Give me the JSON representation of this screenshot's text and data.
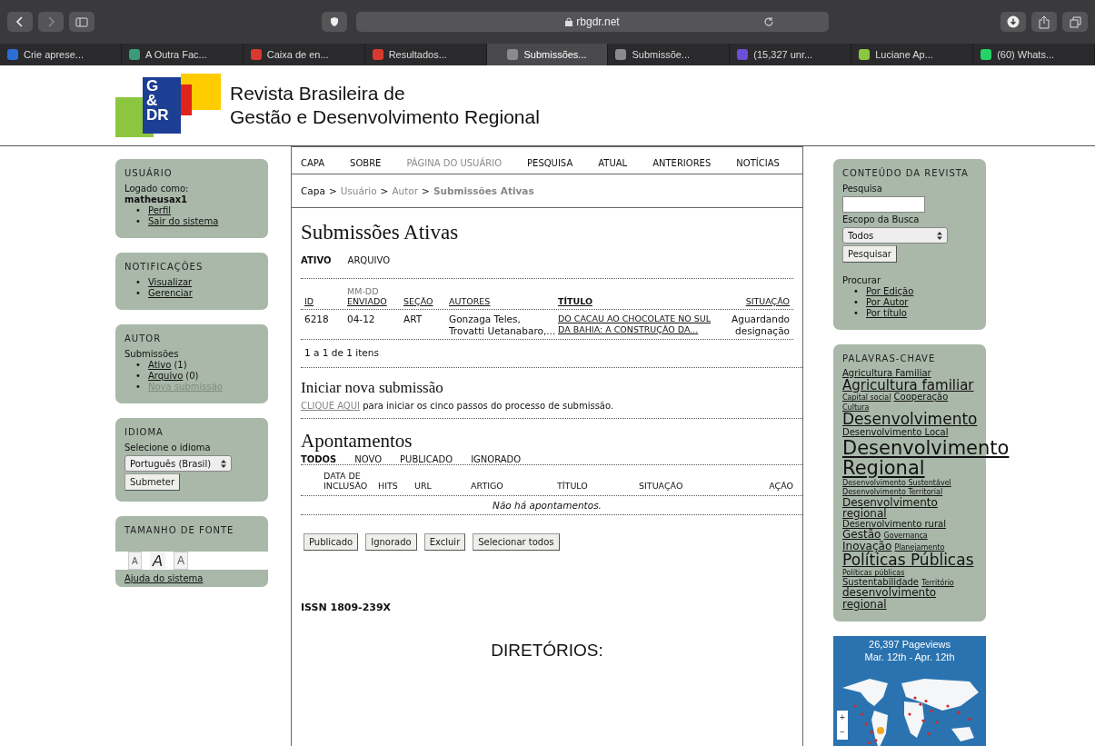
{
  "browser": {
    "address": "rbgdr.net",
    "tabs": [
      {
        "label": "Crie aprese...",
        "color": "#2b6fd6",
        "selected": false
      },
      {
        "label": "A Outra Fac...",
        "color": "#3a9a7a",
        "selected": false
      },
      {
        "label": "Caixa de en...",
        "color": "#d93a2f",
        "selected": false
      },
      {
        "label": "Resultados...",
        "color": "#d93a2f",
        "selected": false
      },
      {
        "label": "Submissões...",
        "color": "#8a8a8e",
        "selected": true
      },
      {
        "label": "Submissõe...",
        "color": "#8a8a8e",
        "selected": false
      },
      {
        "label": "(15,327 unr...",
        "color": "#6b4fd6",
        "selected": false
      },
      {
        "label": "Luciane Ap...",
        "color": "#8cc63f",
        "selected": false
      },
      {
        "label": "(60) Whats...",
        "color": "#25d366",
        "selected": false
      }
    ]
  },
  "header": {
    "logo_letters": [
      "G",
      "&",
      "DR"
    ],
    "title_line_1": "Revista Brasileira de",
    "title_line_2": "Gestão e Desenvolvimento Regional"
  },
  "left_sidebar": {
    "user": {
      "title": "USUÁRIO",
      "logged_label": "Logado como:",
      "username": "matheusax1",
      "links": [
        "Perfil",
        "Sair do sistema"
      ]
    },
    "notifications": {
      "title": "NOTIFICAÇÕES",
      "links": [
        "Visualizar",
        "Gerenciar"
      ]
    },
    "author": {
      "title": "AUTOR",
      "subtitle": "Submissões",
      "items": [
        {
          "link": "Ativo",
          "count": "(1)",
          "disabled": false
        },
        {
          "link": "Arquivo",
          "count": "(0)",
          "disabled": false
        },
        {
          "link": "Nova submissão",
          "disabled": true
        }
      ]
    },
    "language": {
      "title": "IDIOMA",
      "label": "Selecione o idioma",
      "value": "Português (Brasil)",
      "button": "Submeter"
    },
    "font_size": {
      "title": "TAMANHO DE FONTE",
      "buttons": [
        {
          "label": "A",
          "kind": "smaller"
        },
        {
          "label": "A",
          "kind": "default"
        },
        {
          "label": "A",
          "kind": "larger"
        }
      ]
    },
    "help": "Ajuda do sistema"
  },
  "nav": [
    {
      "label": "CAPA",
      "selected": false
    },
    {
      "label": "SOBRE",
      "selected": false
    },
    {
      "label": "PÁGINA DO USUÁRIO",
      "selected": true
    },
    {
      "label": "PESQUISA",
      "selected": false
    },
    {
      "label": "ATUAL",
      "selected": false
    },
    {
      "label": "ANTERIORES",
      "selected": false
    },
    {
      "label": "NOTÍCIAS",
      "selected": false
    }
  ],
  "list_bullet": "•",
  "breadcrumb_separator": ">",
  "breadcrumb": [
    {
      "label": "Capa",
      "kind": "link"
    },
    {
      "label": "Usuário",
      "kind": "muted"
    },
    {
      "label": "Autor",
      "kind": "muted"
    },
    {
      "label": "Submissões Ativas",
      "kind": "current"
    }
  ],
  "page_title": "Submissões Ativas",
  "submission_tabs": [
    {
      "label": "ATIVO",
      "selected": true
    },
    {
      "label": "ARQUIVO",
      "selected": false
    }
  ],
  "submissions_table": {
    "date_format": "MM-DD",
    "columns": [
      {
        "label": "ID",
        "selected": false
      },
      {
        "label": "ENVIADO",
        "selected": false
      },
      {
        "label": "SEÇÃO",
        "selected": false
      },
      {
        "label": "AUTORES",
        "selected": false
      },
      {
        "label": "TÍTULO",
        "selected": true
      },
      {
        "label": "SITUAÇÃO",
        "selected": false
      }
    ],
    "rows": [
      {
        "id": "6218",
        "sent": "04-12",
        "section": "ART",
        "authors": "Gonzaga Teles, Trovatti Uetanabaro,...",
        "title": "DO CACAU AO CHOCOLATE NO SUL DA BAHIA: A CONSTRUÇÃO DA...",
        "status": "Aguardando designação"
      }
    ],
    "count": "1 a 1 de 1 itens"
  },
  "new_submission": {
    "heading": "Iniciar nova submissão",
    "link": "CLIQUE AQUI",
    "text": "para iniciar os cinco passos do processo de submissão."
  },
  "notes": {
    "heading": "Apontamentos",
    "tabs": [
      {
        "label": "TODOS",
        "selected": true
      },
      {
        "label": "NOVO",
        "selected": false
      },
      {
        "label": "PUBLICADO",
        "selected": false
      },
      {
        "label": "IGNORADO",
        "selected": false
      }
    ],
    "columns": [
      "DATA DE INCLUSÃO",
      "HITS",
      "URL",
      "ARTIGO",
      "TÍTULO",
      "SITUAÇÃO",
      "AÇÃO"
    ],
    "empty": "Não há apontamentos.",
    "buttons": [
      "Publicado",
      "Ignorado",
      "Excluir",
      "Selecionar todos"
    ]
  },
  "issn": "ISSN 1809-239X",
  "directories": "DIRETÓRIOS:",
  "right_sidebar": {
    "content": {
      "title": "CONTEÚDO DA REVISTA",
      "search_label": "Pesquisa",
      "scope_label": "Escopo da Busca",
      "scope_value": "Todos",
      "search_button": "Pesquisar",
      "browse_label": "Procurar",
      "browse_links": [
        "Por Edição",
        "Por Autor",
        "Por título"
      ]
    },
    "keywords": {
      "title": "PALAVRAS-CHAVE",
      "items": [
        {
          "label": "Agricultura Familiar",
          "kind": "s"
        },
        {
          "label": "Agricultura familiar",
          "kind": "l"
        },
        {
          "label": "Capital social",
          "kind": "xs"
        },
        {
          "label": "Cooperação",
          "kind": "s"
        },
        {
          "label": "Cultura",
          "kind": "xs"
        },
        {
          "label": "Desenvolvimento",
          "kind": "xl"
        },
        {
          "label": "Desenvolvimento Local",
          "kind": "s"
        },
        {
          "label": "Desenvolvimento Regional",
          "kind": "xxl"
        },
        {
          "label": "Desenvolvimento Sustentável",
          "kind": "xs"
        },
        {
          "label": "Desenvolvimento Territorial",
          "kind": "xs"
        },
        {
          "label": "Desenvolvimento regional",
          "kind": "m"
        },
        {
          "label": "Desenvolvimento rural",
          "kind": "s"
        },
        {
          "label": "Gestão",
          "kind": "m"
        },
        {
          "label": "Governança",
          "kind": "xs"
        },
        {
          "label": "Inovação",
          "kind": "m"
        },
        {
          "label": "Planejamento",
          "kind": "xs"
        },
        {
          "label": "Políticas Públicas",
          "kind": "xl"
        },
        {
          "label": "Políticas públicas",
          "kind": "xs"
        },
        {
          "label": "Sustentabilidade",
          "kind": "s"
        },
        {
          "label": "Território",
          "kind": "xs"
        },
        {
          "label": "desenvolvimento regional",
          "kind": "m"
        }
      ]
    },
    "stats": {
      "line_1": "26,397 Pageviews",
      "line_2": "Mar. 12th - Apr. 12th",
      "zoom_in": "+",
      "zoom_out": "−"
    }
  }
}
